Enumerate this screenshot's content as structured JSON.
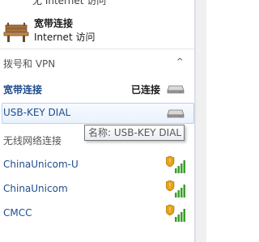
{
  "partial_top": "无 Internet 访问",
  "connection": {
    "name": "宽带连接",
    "status": "Internet 访问"
  },
  "dialup_section": {
    "label": "拨号和 VPN",
    "collapse_glyph": "^",
    "items": [
      {
        "label": "宽带连接",
        "status": "已连接"
      },
      {
        "label": "USB-KEY DIAL"
      }
    ]
  },
  "tooltip": "名称: USB-KEY DIAL",
  "wireless_section": {
    "label": "无线网络连接",
    "networks": [
      {
        "label": "ChinaUnicom-U"
      },
      {
        "label": "ChinaUnicom"
      },
      {
        "label": "CMCC"
      }
    ]
  }
}
